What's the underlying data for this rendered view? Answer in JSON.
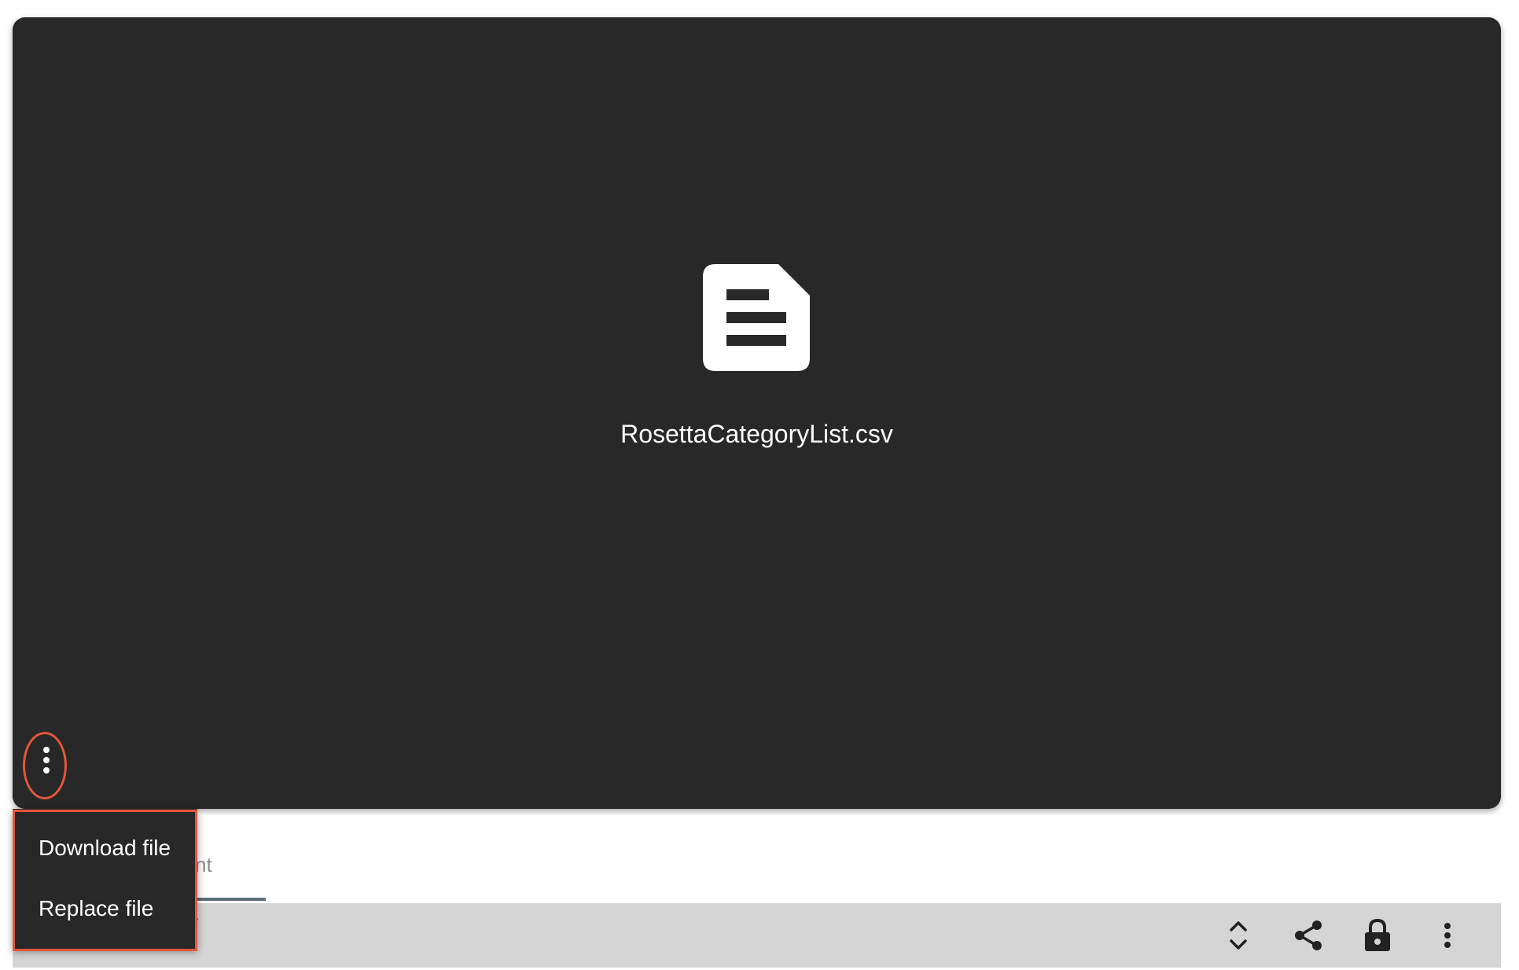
{
  "viewer": {
    "file_name": "RosettaCategoryList.csv",
    "file_icon": "document-icon",
    "more_icon": "more-vert-icon"
  },
  "menu": {
    "items": [
      {
        "label": "Download file"
      },
      {
        "label": "Replace file"
      }
    ]
  },
  "tab": {
    "label_partial": "nt"
  },
  "toolbar": {
    "partial_text": "/",
    "icons": [
      "expand-collapse-icon",
      "share-icon",
      "lock-icon",
      "more-vert-icon"
    ]
  },
  "colors": {
    "viewer_bg": "#282828",
    "highlight": "#e4563a",
    "toolbar_bg": "#d5d5d5"
  }
}
